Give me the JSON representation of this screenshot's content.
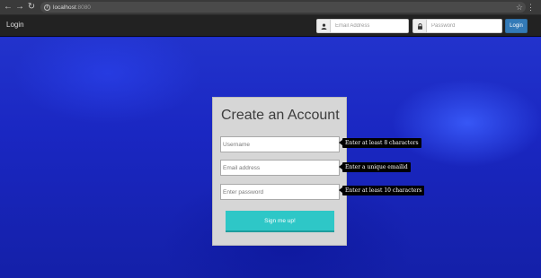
{
  "browser": {
    "back_icon": "arrow-left-icon",
    "forward_icon": "arrow-right-icon",
    "reload_icon": "reload-icon",
    "url_host": "localhost",
    "url_port": ":8080",
    "star_icon": "star-icon",
    "menu_icon": "more-vert-icon"
  },
  "navbar": {
    "brand": "Login",
    "email_placeholder": "Email Address",
    "password_placeholder": "Password",
    "login_button": "Login",
    "user_icon": "user-icon",
    "lock_icon": "lock-icon"
  },
  "signup": {
    "title": "Create an Account",
    "username_placeholder": "Username",
    "email_placeholder": "Email address",
    "password_placeholder": "Enter password",
    "submit_label": "Sign me up!",
    "tooltips": {
      "username": "Enter at least 8 characters",
      "email": "Enter a unique emailid",
      "password": "Enter at least 10 characters"
    }
  },
  "colors": {
    "background": "#1a2bd0",
    "navbar": "#222222",
    "login_button": "#337ab7",
    "card": "#d6d6d6",
    "signup_button": "#2ec7c7"
  }
}
